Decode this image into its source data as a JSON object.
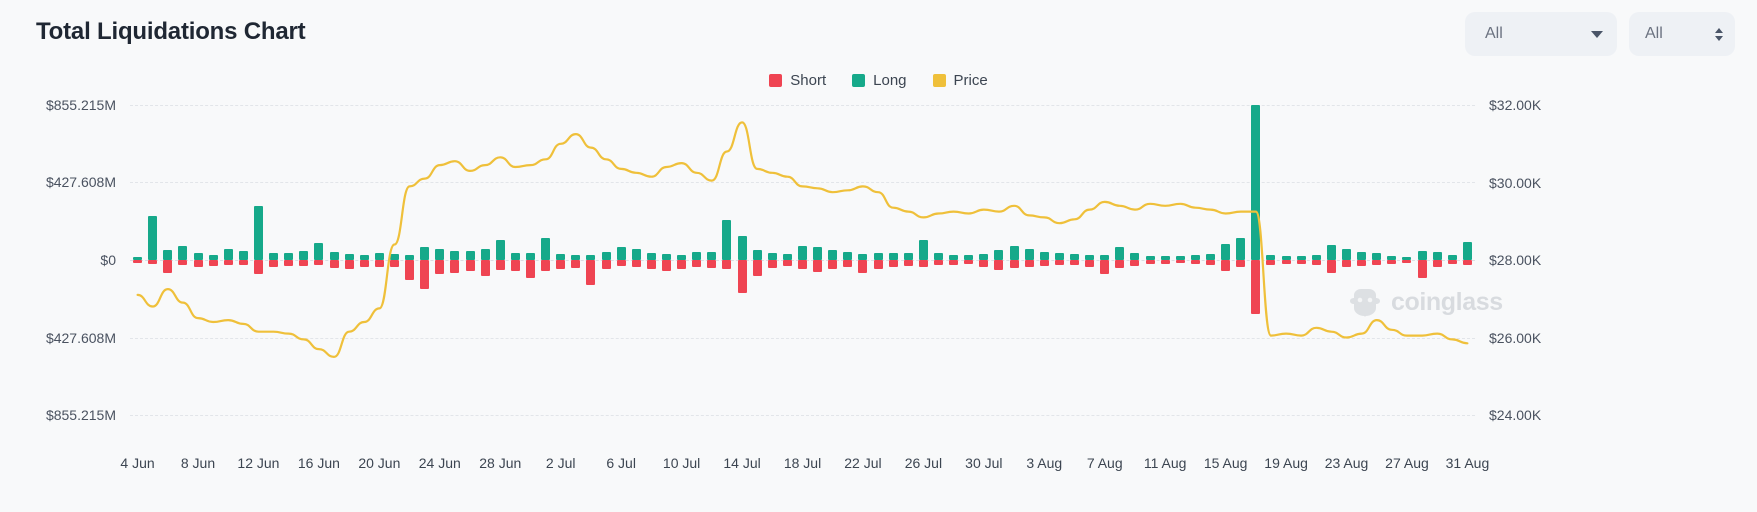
{
  "header": {
    "title": "Total Liquidations Chart",
    "controls": [
      {
        "name": "range-select",
        "label": "All",
        "icon": "chevron-down-icon"
      },
      {
        "name": "coin-select",
        "label": "All",
        "icon": "stepper-updown-icon"
      }
    ]
  },
  "watermark": {
    "text": "coinglass",
    "icon": "coinglass-whale-icon"
  },
  "colors": {
    "long": "#16a98a",
    "short": "#ef4452",
    "price": "#efc03a",
    "background": "#f8f9fa",
    "grid": "#e2e5e9",
    "text": "#3c4551"
  },
  "chart_data": {
    "type": "bar",
    "title": "Total Liquidations Chart",
    "xlabel": "",
    "ylabel": "Liquidations (USD)",
    "y2label": "Price (USD)",
    "grid": true,
    "legend_position": "top-center",
    "legend": [
      {
        "name": "Short",
        "color": "#ef4452"
      },
      {
        "name": "Long",
        "color": "#16a98a"
      },
      {
        "name": "Price",
        "color": "#efc03a"
      }
    ],
    "ylim": [
      -855215000,
      855215000
    ],
    "y_ticklabels": [
      "$855.215M",
      "$427.608M",
      "$0",
      "$427.608M",
      "$855.215M"
    ],
    "y_tickvalues": [
      855215000,
      427608000,
      0,
      -427608000,
      -855215000
    ],
    "y2lim": [
      24000,
      32000
    ],
    "y2_ticklabels": [
      "$32.00K",
      "$30.00K",
      "$28.00K",
      "$26.00K",
      "$24.00K"
    ],
    "y2_tickvalues": [
      32000,
      30000,
      28000,
      26000,
      24000
    ],
    "x_ticklabels": [
      "4 Jun",
      "8 Jun",
      "12 Jun",
      "16 Jun",
      "20 Jun",
      "24 Jun",
      "28 Jun",
      "2 Jul",
      "6 Jul",
      "10 Jul",
      "14 Jul",
      "18 Jul",
      "22 Jul",
      "26 Jul",
      "30 Jul",
      "3 Aug",
      "7 Aug",
      "11 Aug",
      "15 Aug",
      "19 Aug",
      "23 Aug",
      "27 Aug",
      "31 Aug"
    ],
    "x_tickvalues": [
      0,
      4,
      8,
      12,
      16,
      20,
      24,
      28,
      32,
      36,
      40,
      44,
      48,
      52,
      56,
      60,
      64,
      68,
      72,
      76,
      80,
      84,
      88
    ],
    "dates": [
      "4 Jun",
      "5 Jun",
      "6 Jun",
      "7 Jun",
      "8 Jun",
      "9 Jun",
      "10 Jun",
      "11 Jun",
      "12 Jun",
      "13 Jun",
      "14 Jun",
      "15 Jun",
      "16 Jun",
      "17 Jun",
      "18 Jun",
      "19 Jun",
      "20 Jun",
      "21 Jun",
      "22 Jun",
      "23 Jun",
      "24 Jun",
      "25 Jun",
      "26 Jun",
      "27 Jun",
      "28 Jun",
      "29 Jun",
      "30 Jun",
      "1 Jul",
      "2 Jul",
      "3 Jul",
      "4 Jul",
      "5 Jul",
      "6 Jul",
      "7 Jul",
      "8 Jul",
      "9 Jul",
      "10 Jul",
      "11 Jul",
      "12 Jul",
      "13 Jul",
      "14 Jul",
      "15 Jul",
      "16 Jul",
      "17 Jul",
      "18 Jul",
      "19 Jul",
      "20 Jul",
      "21 Jul",
      "22 Jul",
      "23 Jul",
      "24 Jul",
      "25 Jul",
      "26 Jul",
      "27 Jul",
      "28 Jul",
      "29 Jul",
      "30 Jul",
      "31 Jul",
      "1 Aug",
      "2 Aug",
      "3 Aug",
      "4 Aug",
      "5 Aug",
      "6 Aug",
      "7 Aug",
      "8 Aug",
      "9 Aug",
      "10 Aug",
      "11 Aug",
      "12 Aug",
      "13 Aug",
      "14 Aug",
      "15 Aug",
      "16 Aug",
      "17 Aug",
      "18 Aug",
      "19 Aug",
      "20 Aug",
      "21 Aug",
      "22 Aug",
      "23 Aug",
      "24 Aug",
      "25 Aug",
      "26 Aug",
      "27 Aug",
      "28 Aug",
      "29 Aug",
      "30 Aug",
      "31 Aug"
    ],
    "series": [
      {
        "name": "Long",
        "color": "#16a98a",
        "unit": "USD",
        "values": [
          18000000,
          245000000,
          55000000,
          75000000,
          40000000,
          30000000,
          62000000,
          48000000,
          300000000,
          36000000,
          40000000,
          52000000,
          95000000,
          44000000,
          32000000,
          30000000,
          36000000,
          34000000,
          30000000,
          72000000,
          62000000,
          48000000,
          52000000,
          58000000,
          110000000,
          40000000,
          36000000,
          120000000,
          34000000,
          30000000,
          28000000,
          46000000,
          72000000,
          60000000,
          40000000,
          34000000,
          30000000,
          44000000,
          46000000,
          220000000,
          130000000,
          56000000,
          36000000,
          34000000,
          80000000,
          70000000,
          56000000,
          44000000,
          34000000,
          36000000,
          38000000,
          40000000,
          110000000,
          36000000,
          30000000,
          26000000,
          34000000,
          56000000,
          80000000,
          60000000,
          44000000,
          36000000,
          34000000,
          30000000,
          28000000,
          70000000,
          36000000,
          24000000,
          22000000,
          20000000,
          26000000,
          32000000,
          86000000,
          120000000,
          855000000,
          30000000,
          22000000,
          20000000,
          26000000,
          82000000,
          60000000,
          44000000,
          40000000,
          22000000,
          18000000,
          52000000,
          44000000,
          26000000,
          100000000
        ],
        "note": "Positive bars drawn above the $0 baseline"
      },
      {
        "name": "Short",
        "color": "#ef4452",
        "unit": "USD",
        "values": [
          -16000000,
          -22000000,
          -70000000,
          -30000000,
          -36000000,
          -34000000,
          -30000000,
          -28000000,
          -80000000,
          -36000000,
          -32000000,
          -34000000,
          -30000000,
          -44000000,
          -52000000,
          -40000000,
          -38000000,
          -36000000,
          -110000000,
          -160000000,
          -80000000,
          -70000000,
          -58000000,
          -90000000,
          -54000000,
          -62000000,
          -100000000,
          -60000000,
          -48000000,
          -44000000,
          -140000000,
          -50000000,
          -34000000,
          -36000000,
          -48000000,
          -60000000,
          -52000000,
          -40000000,
          -44000000,
          -50000000,
          -180000000,
          -90000000,
          -46000000,
          -34000000,
          -52000000,
          -66000000,
          -48000000,
          -40000000,
          -70000000,
          -52000000,
          -36000000,
          -34000000,
          -40000000,
          -30000000,
          -26000000,
          -24000000,
          -40000000,
          -56000000,
          -44000000,
          -36000000,
          -34000000,
          -30000000,
          -28000000,
          -40000000,
          -76000000,
          -46000000,
          -34000000,
          -24000000,
          -20000000,
          -18000000,
          -22000000,
          -30000000,
          -60000000,
          -36000000,
          -300000000,
          -30000000,
          -24000000,
          -20000000,
          -26000000,
          -70000000,
          -40000000,
          -34000000,
          -26000000,
          -20000000,
          -16000000,
          -100000000,
          -36000000,
          -22000000,
          -30000000
        ],
        "note": "Negative bars drawn below the $0 baseline"
      },
      {
        "name": "Price",
        "color": "#efc03a",
        "unit": "USD",
        "axis": "right",
        "values": [
          27100,
          26800,
          27250,
          26900,
          26500,
          26400,
          26450,
          26350,
          26150,
          26150,
          26100,
          25950,
          25700,
          25500,
          26150,
          26400,
          26750,
          28400,
          29900,
          30100,
          30450,
          30550,
          30300,
          30450,
          30650,
          30400,
          30450,
          30600,
          31000,
          31250,
          30900,
          30600,
          30350,
          30250,
          30150,
          30400,
          30500,
          30250,
          30050,
          30800,
          31550,
          30350,
          30250,
          30150,
          29900,
          29850,
          29750,
          29800,
          29900,
          29750,
          29350,
          29250,
          29100,
          29200,
          29250,
          29200,
          29300,
          29250,
          29400,
          29150,
          29100,
          28950,
          29050,
          29300,
          29500,
          29400,
          29300,
          29450,
          29400,
          29450,
          29350,
          29300,
          29200,
          29250,
          29250,
          26050,
          26100,
          26050,
          26250,
          26150,
          26000,
          26100,
          26450,
          26200,
          26050,
          26050,
          26100,
          25950,
          25850
        ]
      }
    ]
  }
}
